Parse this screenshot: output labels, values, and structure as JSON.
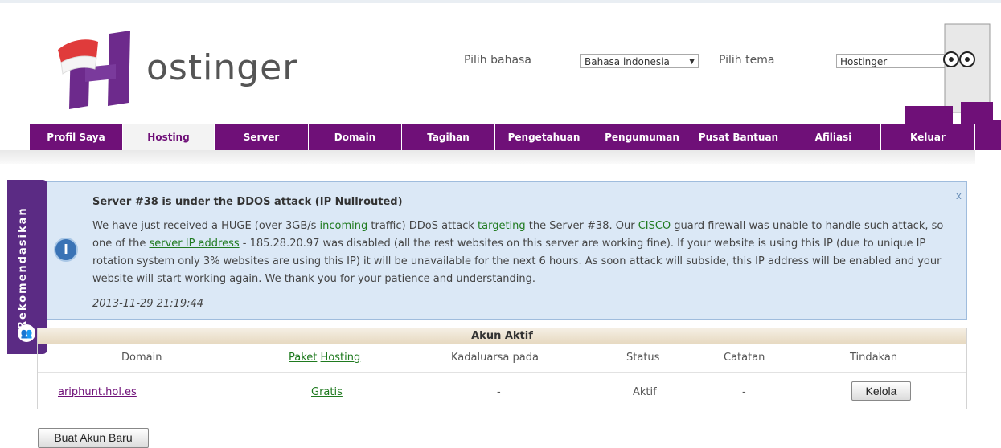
{
  "header": {
    "brand": "ostinger",
    "language_label": "Pilih bahasa",
    "language_value": "Bahasa indonesia",
    "theme_label": "Pilih tema",
    "theme_value": "Hostinger"
  },
  "nav": {
    "tabs": [
      {
        "label": "Profil Saya"
      },
      {
        "label": "Hosting"
      },
      {
        "label": "Server"
      },
      {
        "label": "Domain"
      },
      {
        "label": "Tagihan"
      },
      {
        "label": "Pengetahuan"
      },
      {
        "label": "Pengumuman"
      },
      {
        "label": "Pusat Bantuan"
      },
      {
        "label": "Afiliasi"
      },
      {
        "label": "Keluar"
      }
    ],
    "active_tab": "Hosting"
  },
  "side": {
    "label": "Rekomendasikan"
  },
  "alert": {
    "title": "Server #38 is under the DDOS attack (IP Nullrouted)",
    "text_1": "We have just received a HUGE (over 3GB/s ",
    "link_1": "incoming",
    "text_2": " traffic) DDoS attack ",
    "link_2": "targeting",
    "text_3": " the Server #38. Our ",
    "link_3": "CISCO",
    "text_4": " guard firewall was unable to handle such attack, so one of the ",
    "link_4": "server IP address",
    "text_5": " - 185.28.20.97 was disabled (all the rest websites on this server are working fine). If your website is using this IP (due to unique IP rotation system only 3% websites are using this IP) it will be unavailable for the next 6 hours. As soon attack will subside, this IP address will be enabled and your website will start working again. We thank you for your patience and understanding.",
    "date": "2013-11-29 21:19:44",
    "close": "x"
  },
  "accounts": {
    "title": "Akun Aktif",
    "headers": {
      "domain": "Domain",
      "paket": "Paket",
      "hosting": "Hosting",
      "expires": "Kadaluarsa pada",
      "status": "Status",
      "notes": "Catatan",
      "action": "Tindakan"
    },
    "rows": [
      {
        "domain": "ariphunt.hol.es",
        "plan": "Gratis",
        "expires": "-",
        "status": "Aktif",
        "notes": "-",
        "action": "Kelola"
      }
    ]
  },
  "footer": {
    "new_account_button": "Buat Akun Baru"
  }
}
